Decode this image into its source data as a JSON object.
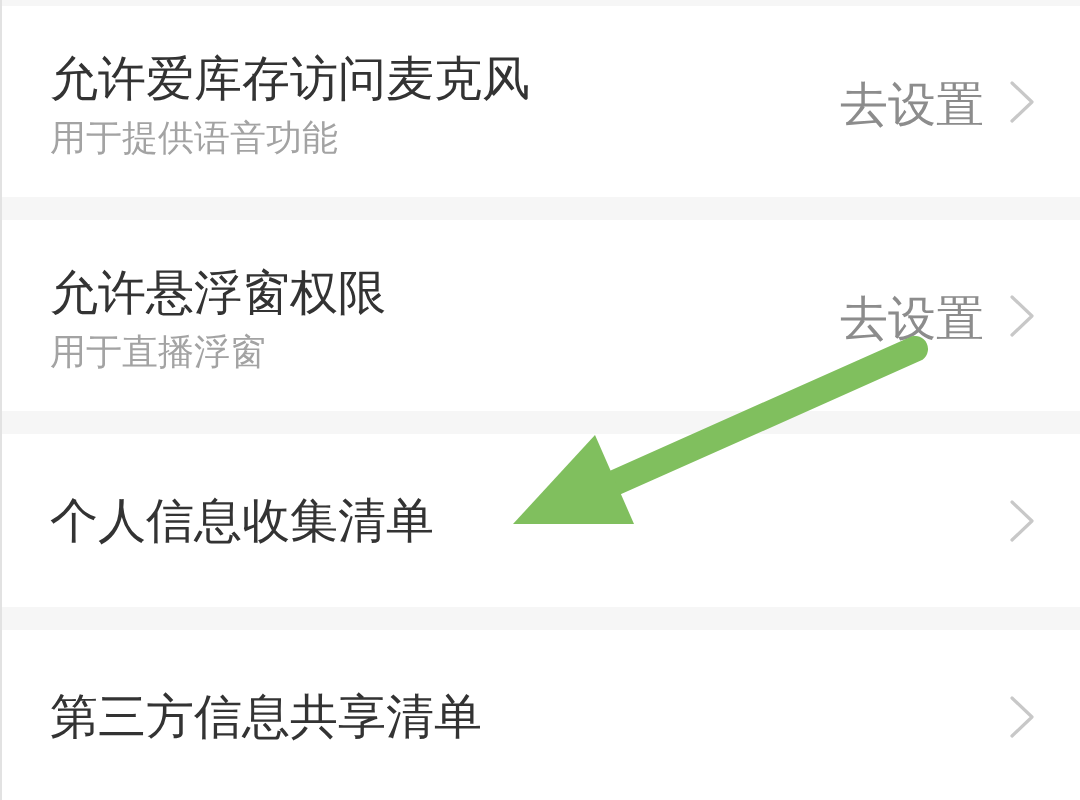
{
  "rows": [
    {
      "kind": "permission",
      "title": "允许爱库存访问麦克风",
      "subtitle": "用于提供语音功能",
      "action": "去设置"
    },
    {
      "kind": "permission",
      "title": "允许悬浮窗权限",
      "subtitle": "用于直播浮窗",
      "action": "去设置"
    },
    {
      "kind": "link",
      "title": "个人信息收集清单"
    },
    {
      "kind": "link",
      "title": "第三方信息共享清单"
    }
  ]
}
